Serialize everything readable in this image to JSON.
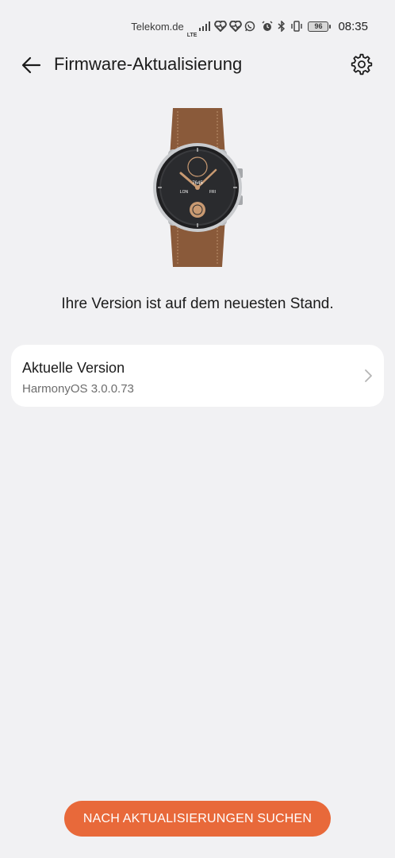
{
  "status_bar": {
    "carrier": "Telekom.de",
    "network": "LTE",
    "battery": "96",
    "time": "08:35"
  },
  "header": {
    "title": "Firmware-Aktualisierung"
  },
  "watch": {
    "readout": "7645",
    "city": "LON",
    "day": "FRI"
  },
  "main": {
    "status_message": "Ihre Version ist auf dem neuesten Stand."
  },
  "version_card": {
    "label": "Aktuelle Version",
    "value": "HarmonyOS 3.0.0.73"
  },
  "footer": {
    "button_label": "NACH AKTUALISIERUNGEN SUCHEN"
  },
  "colors": {
    "accent": "#e8693a",
    "background": "#f1f1f3",
    "card": "#ffffff"
  }
}
